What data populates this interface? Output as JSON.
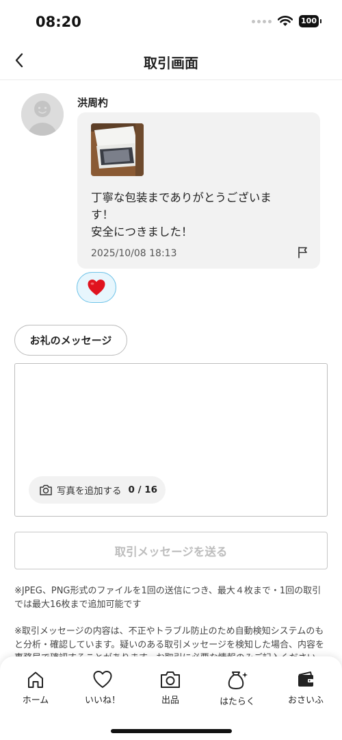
{
  "status_bar": {
    "time": "08:20",
    "battery": "100",
    "icons": [
      "signal-dots-icon",
      "wifi-icon",
      "battery-icon"
    ]
  },
  "header": {
    "title": "取引画面",
    "back_icon": "chevron-left-icon"
  },
  "message": {
    "sender_name": "洪周杓",
    "avatar_icon": "default-avatar-icon",
    "photo": "tablet-in-box-photo",
    "text_lines": [
      "丁寧な包装までありがとうございま",
      "す！",
      "安全につきました！"
    ],
    "date": "2025/10/08 18:13",
    "flag_icon": "flag-icon",
    "reaction_icon": "heart-icon",
    "reaction_color": "#e0131e"
  },
  "compose": {
    "thanks_chip": "お礼のメッセージ",
    "input_value": "",
    "photo_button_label": "写真を追加する",
    "photo_count": "0 / 16",
    "photo_icon": "camera-icon",
    "send_button": "取引メッセージを送る"
  },
  "notes": {
    "note1": "※JPEG、PNG形式のファイルを1回の送信につき、最大４枚まで・1回の取引では最大16枚まで追加可能です",
    "note2": "※取引メッセージの内容は、不正やトラブル防止のため自動検知システムのもと分析・確認しています。疑いのある取引メッセージを検知した場合、内容を事務局で確認することがあります。お取引に必要な情報のみご記入ください"
  },
  "tab_bar": {
    "tabs": [
      {
        "label": "ホーム",
        "icon": "home-icon"
      },
      {
        "label": "いいね！",
        "icon": "heart-outline-icon"
      },
      {
        "label": "出品",
        "icon": "camera-icon"
      },
      {
        "label": "はたらく",
        "icon": "money-bag-icon"
      },
      {
        "label": "おさいふ",
        "icon": "wallet-icon"
      }
    ]
  },
  "colors": {
    "reaction_bg": "#e7f6fd",
    "reaction_border": "#6fc3e8",
    "bubble_bg": "#f2f2f2",
    "disabled_text": "#bdbdbd"
  }
}
